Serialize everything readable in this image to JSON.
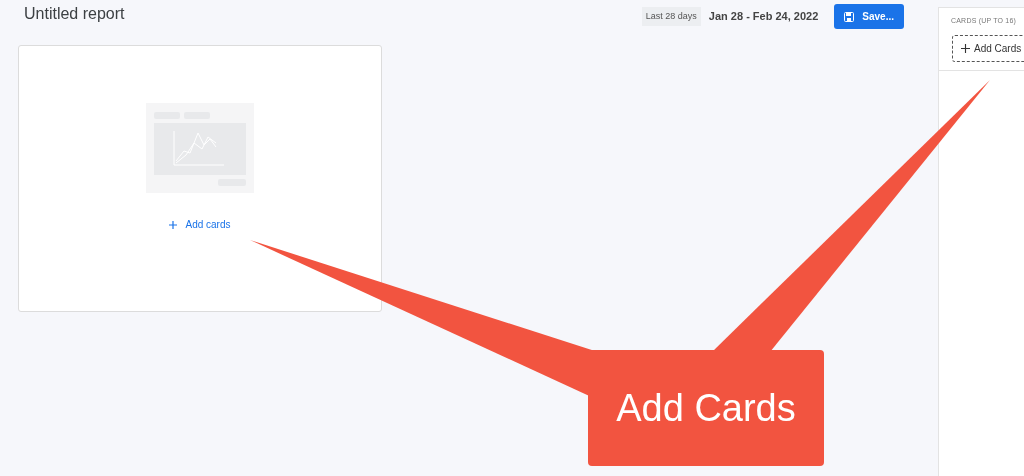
{
  "report": {
    "title": "Untitled report",
    "date_range_label": "Last 28 days",
    "date_range": "Jan 28 - Feb 24, 2022",
    "save_button": "Save..."
  },
  "canvas": {
    "add_link": "Add cards"
  },
  "side_panel": {
    "section_title": "CARDS (UP TO 16)",
    "add_button": "Add Cards"
  },
  "callout": {
    "text": "Add Cards"
  }
}
